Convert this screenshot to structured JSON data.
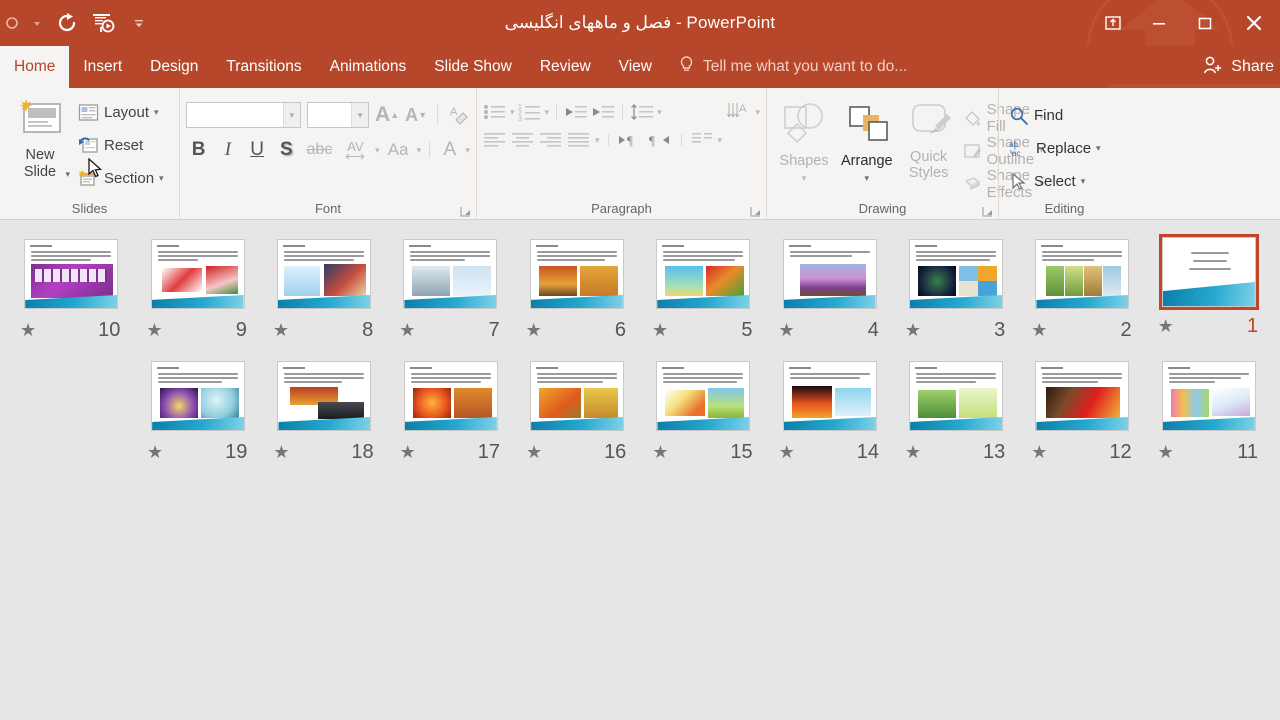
{
  "window": {
    "title": "فصل و ماههای انگلیسی - PowerPoint",
    "quick_access": [
      {
        "name": "autosave-dropdown-icon",
        "glyph": "▾"
      },
      {
        "name": "redo-icon",
        "glyph": "↻"
      },
      {
        "name": "start-presentation-icon",
        "glyph": "▶"
      },
      {
        "name": "customize-quick-access-toolbar-icon",
        "glyph": "▾"
      }
    ],
    "controls": [
      {
        "name": "ribbon-display-options-button",
        "label": "Ribbon Display Options"
      },
      {
        "name": "minimize-button",
        "label": "Minimize"
      },
      {
        "name": "restore-button",
        "label": "Restore Down"
      },
      {
        "name": "close-button",
        "label": "Close"
      }
    ],
    "accent_color": "#b7472a",
    "ribbon_bg": "#f5f4f2"
  },
  "tabs": [
    {
      "label": "Home",
      "active": true
    },
    {
      "label": "Insert",
      "active": false
    },
    {
      "label": "Design",
      "active": false
    },
    {
      "label": "Transitions",
      "active": false
    },
    {
      "label": "Animations",
      "active": false
    },
    {
      "label": "Slide Show",
      "active": false
    },
    {
      "label": "Review",
      "active": false
    },
    {
      "label": "View",
      "active": false
    }
  ],
  "tell_me": {
    "placeholder": "Tell me what you want to do...",
    "icon": "lightbulb-icon"
  },
  "share": {
    "label": "Share",
    "icon": "person-add-icon"
  },
  "ribbon": {
    "slides": {
      "label": "Slides",
      "new_slide": "New Slide",
      "layout": "Layout",
      "reset": "Reset",
      "section": "Section"
    },
    "font": {
      "label": "Font",
      "font_name_value": "",
      "font_size_value": "",
      "buttons": [
        "increase-font-size",
        "decrease-font-size",
        "clear-formatting",
        "bold",
        "italic",
        "underline",
        "text-shadow",
        "strikethrough",
        "character-spacing",
        "change-case",
        "font-color"
      ],
      "bold": "B",
      "italic": "I",
      "underline": "U",
      "shadow": "S",
      "strikethrough": "abc",
      "spacing": "AV",
      "case": "Aa",
      "color": "A"
    },
    "paragraph": {
      "label": "Paragraph",
      "buttons": [
        "bullets",
        "numbering",
        "decrease-indent",
        "increase-indent",
        "line-spacing",
        "align-left",
        "align-center",
        "align-right",
        "justify",
        "text-direction-ltr",
        "text-direction-rtl",
        "columns",
        "text-direction",
        "align-text",
        "convert-to-smartart"
      ]
    },
    "drawing": {
      "label": "Drawing",
      "shapes": "Shapes",
      "arrange": "Arrange",
      "quick_styles_line1": "Quick",
      "quick_styles_line2": "Styles",
      "shape_fill": "Shape Fill",
      "shape_outline": "Shape Outline",
      "shape_effects": "Shape Effects"
    },
    "editing": {
      "label": "Editing",
      "find": "Find",
      "replace": "Replace",
      "select": "Select"
    }
  },
  "slide_sorter": {
    "view": "Slide Sorter",
    "selected_slide": 1,
    "star_glyph": "★",
    "rows": [
      [
        {
          "number": "10",
          "topic": "March",
          "selected": false
        },
        {
          "number": "9",
          "topic": "February",
          "selected": false
        },
        {
          "number": "8",
          "topic": "January",
          "selected": false
        },
        {
          "number": "7",
          "topic": "Winter",
          "selected": false
        },
        {
          "number": "6",
          "topic": "Autumn",
          "selected": false
        },
        {
          "number": "5",
          "topic": "Summer",
          "selected": false
        },
        {
          "number": "4",
          "topic": "Spring",
          "selected": false
        },
        {
          "number": "3",
          "topic": "Four seasons",
          "selected": false
        },
        {
          "number": "2",
          "topic": "Season",
          "selected": false
        },
        {
          "number": "1",
          "topic": "Title slide",
          "selected": true
        }
      ],
      [
        {
          "number": "19",
          "topic": "December",
          "selected": false
        },
        {
          "number": "18",
          "topic": "November",
          "selected": false
        },
        {
          "number": "17",
          "topic": "October",
          "selected": false
        },
        {
          "number": "16",
          "topic": "September",
          "selected": false
        },
        {
          "number": "15",
          "topic": "August",
          "selected": false
        },
        {
          "number": "14",
          "topic": "July",
          "selected": false
        },
        {
          "number": "13",
          "topic": "June",
          "selected": false
        },
        {
          "number": "12",
          "topic": "May",
          "selected": false
        },
        {
          "number": "11",
          "topic": "April",
          "selected": false
        }
      ]
    ]
  }
}
